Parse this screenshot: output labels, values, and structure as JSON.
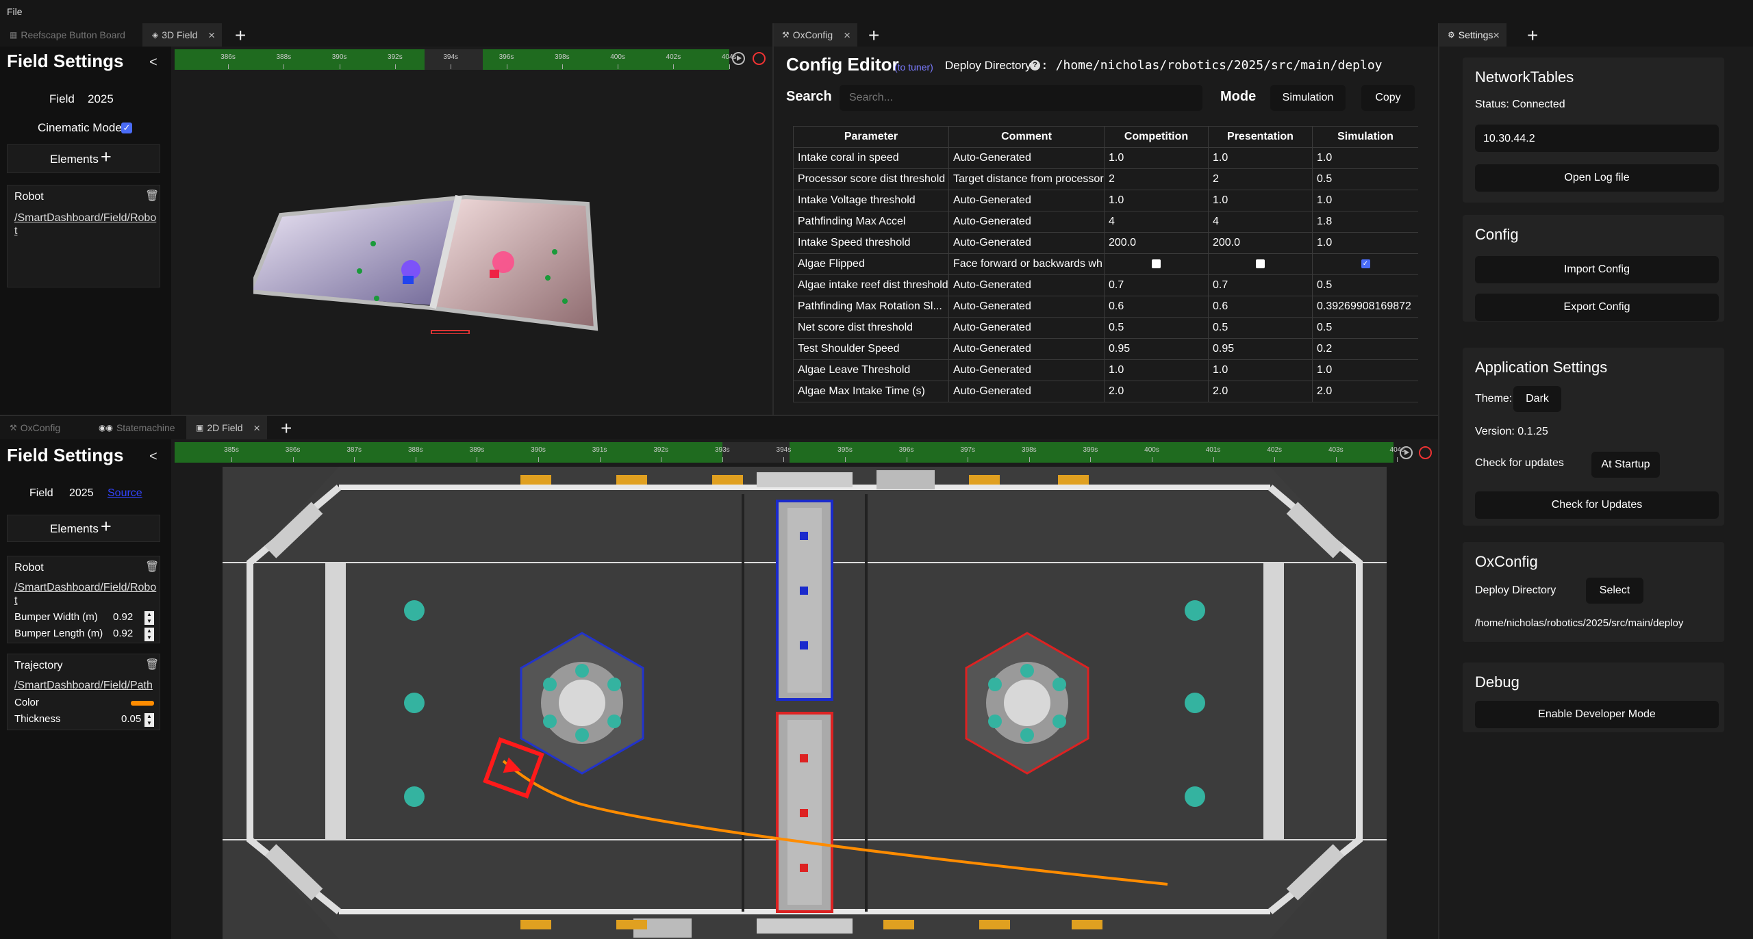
{
  "menu": {
    "file": "File"
  },
  "top_left_tabs": [
    {
      "label": "Reefscape Button Board"
    },
    {
      "label": "3D Field"
    }
  ],
  "top_mid_tabs": [
    {
      "label": "OxConfig"
    }
  ],
  "right_tabs": [
    {
      "label": "Settings"
    }
  ],
  "bottom_tabs": [
    {
      "label": "OxConfig"
    },
    {
      "label": "Statemachine"
    },
    {
      "label": "2D Field"
    }
  ],
  "field3d": {
    "title": "Field Settings",
    "collapse": "<",
    "field_label": "Field",
    "field_value": "2025",
    "cinematic_label": "Cinematic Mode",
    "cinematic_checked": true,
    "elements_label": "Elements",
    "robot_title": "Robot",
    "robot_path": "/SmartDashboard/Field/Robot",
    "timeline_ticks": [
      "386s",
      "388s",
      "390s",
      "392s",
      "394s",
      "396s",
      "398s",
      "400s",
      "402s",
      "404s"
    ]
  },
  "config_editor": {
    "title": "Config Editor",
    "tuner_link": "(to tuner)",
    "deploy_label": "Deploy Directory",
    "help": "?",
    "deploy_path": ": /home/nicholas/robotics/2025/src/main/deploy",
    "search_label": "Search",
    "search_placeholder": "Search...",
    "mode_label": "Mode",
    "mode_value": "Simulation",
    "copy_label": "Copy",
    "columns": [
      "Parameter",
      "Comment",
      "Competition",
      "Presentation",
      "Simulation"
    ],
    "rows": [
      {
        "param": "Intake coral in speed",
        "comment": "Auto-Generated",
        "comp": "1.0",
        "pres": "1.0",
        "sim": "1.0"
      },
      {
        "param": "Processor score dist threshold",
        "comment": "Target distance from processor",
        "comp": "2",
        "pres": "2",
        "sim": "0.5"
      },
      {
        "param": "Intake Voltage threshold",
        "comment": "Auto-Generated",
        "comp": "1.0",
        "pres": "1.0",
        "sim": "1.0"
      },
      {
        "param": "Pathfinding Max Accel",
        "comment": "Auto-Generated",
        "comp": "4",
        "pres": "4",
        "sim": "1.8"
      },
      {
        "param": "Intake Speed threshold",
        "comment": "Auto-Generated",
        "comp": "200.0",
        "pres": "200.0",
        "sim": "1.0"
      },
      {
        "param": "Algae Flipped",
        "comment": "Face forward or backwards wh",
        "comp": "",
        "pres": "",
        "sim": ""
      },
      {
        "param": "Algae intake reef dist threshold",
        "comment": "Auto-Generated",
        "comp": "0.7",
        "pres": "0.7",
        "sim": "0.5"
      },
      {
        "param": "Pathfinding Max Rotation Sl...",
        "comment": "Auto-Generated",
        "comp": "0.6",
        "pres": "0.6",
        "sim": "0.39269908169872"
      },
      {
        "param": "Net score dist threshold",
        "comment": "Auto-Generated",
        "comp": "0.5",
        "pres": "0.5",
        "sim": "0.5"
      },
      {
        "param": "Test Shoulder Speed",
        "comment": "Auto-Generated",
        "comp": "0.95",
        "pres": "0.95",
        "sim": "0.2"
      },
      {
        "param": "Algae Leave Threshold",
        "comment": "Auto-Generated",
        "comp": "1.0",
        "pres": "1.0",
        "sim": "1.0"
      },
      {
        "param": "Algae Max Intake Time (s)",
        "comment": "Auto-Generated",
        "comp": "2.0",
        "pres": "2.0",
        "sim": "2.0"
      }
    ]
  },
  "field2d": {
    "title": "Field Settings",
    "collapse": "<",
    "field_label": "Field",
    "field_value": "2025",
    "field_link": "Source",
    "elements_label": "Elements",
    "robot_title": "Robot",
    "robot_path": "/SmartDashboard/Field/Robot",
    "bumper_width_label": "Bumper Width (m)",
    "bumper_width": "0.92",
    "bumper_length_label": "Bumper Length (m)",
    "bumper_length": "0.92",
    "traj_title": "Trajectory",
    "traj_path": "/SmartDashboard/Field/Path",
    "color_label": "Color",
    "thickness_label": "Thickness",
    "thickness": "0.05",
    "timeline_ticks": [
      "385s",
      "386s",
      "387s",
      "388s",
      "389s",
      "390s",
      "391s",
      "392s",
      "393s",
      "394s",
      "395s",
      "396s",
      "397s",
      "398s",
      "399s",
      "400s",
      "401s",
      "402s",
      "403s",
      "404s"
    ]
  },
  "settings": {
    "nt_title": "NetworkTables",
    "nt_status": "Status: Connected",
    "nt_address": "10.30.44.2",
    "open_log": "Open Log file",
    "config_title": "Config",
    "import_config": "Import Config",
    "export_config": "Export Config",
    "app_title": "Application Settings",
    "theme_label": "Theme:",
    "theme_value": "Dark",
    "version": "Version: 0.1.25",
    "check_label": "Check for updates",
    "check_value": "At Startup",
    "check_button": "Check for Updates",
    "ox_title": "OxConfig",
    "deploy_label": "Deploy Directory",
    "select": "Select",
    "deploy_path": "/home/nicholas/robotics/2025/src/main/deploy",
    "debug_title": "Debug",
    "dev_mode": "Enable Developer Mode"
  },
  "colors": {
    "trajectory": "#ff8c00",
    "robot": "#ff1a1a",
    "blue_alliance": "#2233cc",
    "red_alliance": "#dd2222",
    "timeline": "#1f6b1f",
    "checkbox": "#4a6cf7"
  },
  "checkboxes": {
    "algae_flipped_comp": false,
    "algae_flipped_pres": false,
    "algae_flipped_sim": true
  }
}
